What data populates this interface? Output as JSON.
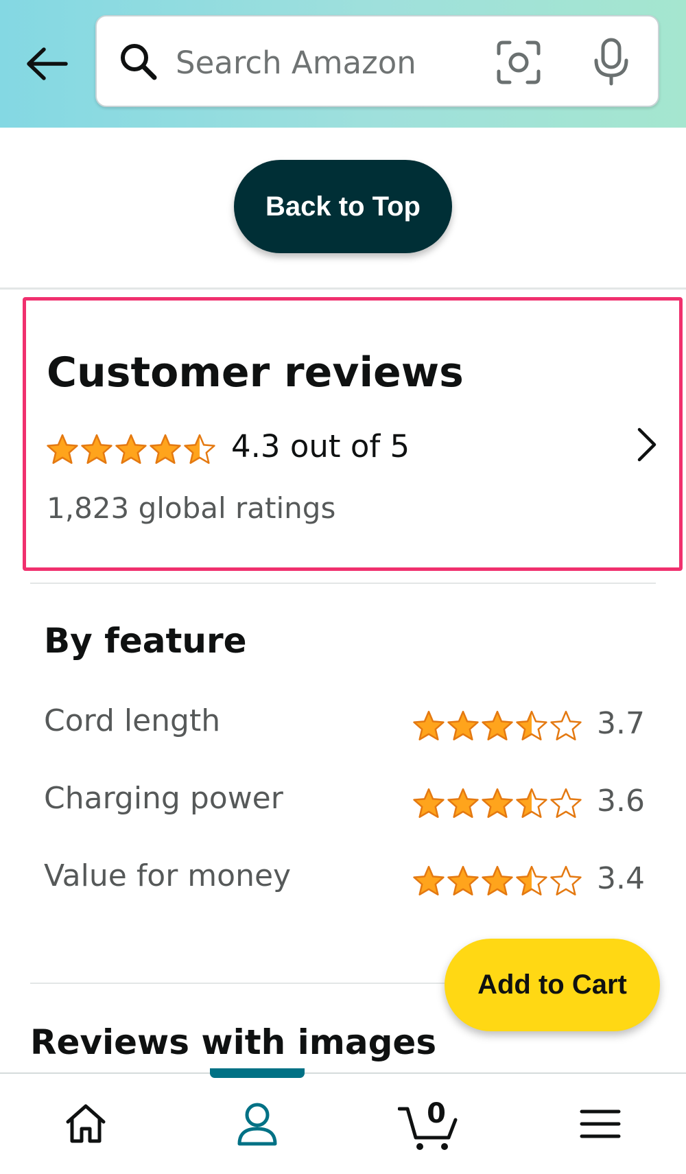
{
  "header": {
    "search_placeholder": "Search Amazon",
    "back_icon": "arrow-left-icon",
    "search_icon": "search-icon",
    "lens_icon": "camera-lens-icon",
    "mic_icon": "microphone-icon"
  },
  "back_to_top": {
    "label": "Back to Top"
  },
  "customer_reviews": {
    "title": "Customer reviews",
    "rating": 4.3,
    "rating_text": "4.3 out of 5",
    "global_ratings": "1,823 global ratings"
  },
  "by_feature": {
    "title": "By feature",
    "features": [
      {
        "label": "Cord length",
        "rating": 3.7,
        "value": "3.7"
      },
      {
        "label": "Charging power",
        "rating": 3.6,
        "value": "3.6"
      },
      {
        "label": "Value for money",
        "rating": 3.4,
        "value": "3.4"
      }
    ]
  },
  "reviews_with_images": {
    "title": "Reviews with images"
  },
  "add_to_cart": {
    "label": "Add to Cart"
  },
  "bottom_nav": {
    "cart_count": "0",
    "items": [
      "home-icon",
      "profile-icon",
      "cart-icon",
      "menu-icon"
    ]
  },
  "colors": {
    "header_gradient_start": "#84d8e3",
    "header_gradient_end": "#a5e6cf",
    "star": "#ffa41c",
    "back_to_top_bg": "#002f36",
    "add_to_cart_bg": "#ffd814",
    "highlight_border": "#f0306e",
    "nav_active": "#007185"
  }
}
